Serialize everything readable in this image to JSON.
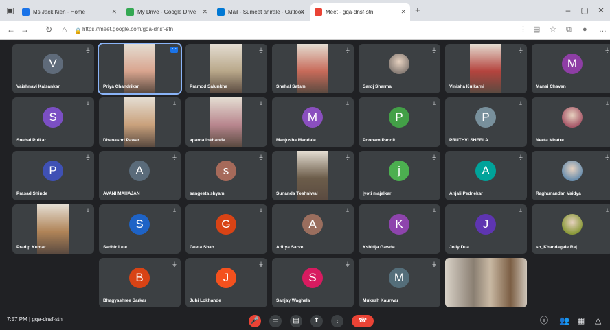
{
  "browser": {
    "tabs": [
      {
        "title": "Ms Jack Kien - Home",
        "color": "#1a73e8"
      },
      {
        "title": "My Drive - Google Drive",
        "color": "#34a853"
      },
      {
        "title": "Mail - Sumeet ahirale - Outlook",
        "color": "#0078d4"
      },
      {
        "title": "Meet - gqa-dnsf-stn",
        "color": "#ea4335"
      }
    ],
    "url": "https://meet.google.com/gqa-dnsf-stn",
    "new_tab": "+"
  },
  "participants": [
    {
      "name": "Vaishnavi Kalsankar",
      "initial": "V",
      "color": "#5f6b7a",
      "type": "avatar"
    },
    {
      "name": "Priya Chandrikar",
      "initial": "",
      "color": "#d9a58f",
      "type": "photo"
    },
    {
      "name": "Pramod Salunkhe",
      "initial": "",
      "color": "#b9a88a",
      "type": "photo"
    },
    {
      "name": "Snehal Satam",
      "initial": "",
      "color": "#c86b5a",
      "type": "photo"
    },
    {
      "name": "Saroj Sharma",
      "initial": "",
      "color": "#8a7f78",
      "type": "small-photo"
    },
    {
      "name": "Vinisha Kulkarni",
      "initial": "",
      "color": "#b5443e",
      "type": "photo"
    },
    {
      "name": "Mansi Chavan",
      "initial": "M",
      "color": "#8e3ea5",
      "type": "avatar"
    },
    {
      "name": "Snehal Pulkar",
      "initial": "S",
      "color": "#7b4fc4",
      "type": "avatar"
    },
    {
      "name": "Dhanashri Pawar",
      "initial": "",
      "color": "#caa27d",
      "type": "photo"
    },
    {
      "name": "aparna lokhande",
      "initial": "",
      "color": "#b9878f",
      "type": "photo"
    },
    {
      "name": "Manjusha Mandale",
      "initial": "M",
      "color": "#8a4fbf",
      "type": "avatar"
    },
    {
      "name": "Poonam Pandit",
      "initial": "P",
      "color": "#43a047",
      "type": "avatar"
    },
    {
      "name": "PRUTHVI SHEELA",
      "initial": "P",
      "color": "#78909c",
      "type": "avatar"
    },
    {
      "name": "Neeta Mhatre",
      "initial": "",
      "color": "#a85a6a",
      "type": "small-photo"
    },
    {
      "name": "Prasad Shinde",
      "initial": "P",
      "color": "#3f51b5",
      "type": "avatar"
    },
    {
      "name": "AVANI MAHAJAN",
      "initial": "A",
      "color": "#5a6b7a",
      "type": "avatar"
    },
    {
      "name": "sangeeta shyam",
      "initial": "s",
      "color": "#a66a5a",
      "type": "avatar"
    },
    {
      "name": "Sunanda Toshniwal",
      "initial": "",
      "color": "#6c5d4a",
      "type": "photo"
    },
    {
      "name": "jyoti majalkar",
      "initial": "j",
      "color": "#4caf50",
      "type": "avatar"
    },
    {
      "name": "Anjali Pednekar",
      "initial": "A",
      "color": "#00a39a",
      "type": "avatar"
    },
    {
      "name": "Raghunandan Vaidya",
      "initial": "",
      "color": "#6b8fae",
      "type": "small-photo"
    },
    {
      "name": "Pradip Kumar",
      "initial": "",
      "color": "#b08458",
      "type": "photo"
    },
    {
      "name": "Sadhir Lele",
      "initial": "S",
      "color": "#1e63c6",
      "type": "avatar"
    },
    {
      "name": "Geeta Shah",
      "initial": "G",
      "color": "#d84315",
      "type": "avatar"
    },
    {
      "name": "Aditya Sarve",
      "initial": "A",
      "color": "#9a6e5e",
      "type": "avatar"
    },
    {
      "name": "Kshitija Gawde",
      "initial": "K",
      "color": "#8e44ad",
      "type": "avatar"
    },
    {
      "name": "Jolly Dua",
      "initial": "J",
      "color": "#5e35b1",
      "type": "avatar"
    },
    {
      "name": "sh_Khandagale Raj",
      "initial": "",
      "color": "#8b9a3a",
      "type": "small-photo"
    },
    {
      "name": "Bhagyashree Sarkar",
      "initial": "B",
      "color": "#d84315",
      "type": "avatar"
    },
    {
      "name": "Juhi Lokhande",
      "initial": "J",
      "color": "#f4511e",
      "type": "avatar"
    },
    {
      "name": "Sanjay Waghela",
      "initial": "S",
      "color": "#d81b60",
      "type": "avatar"
    },
    {
      "name": "Mukesh Kaurwar",
      "initial": "M",
      "color": "#546e7a",
      "type": "avatar"
    },
    {
      "name": "",
      "initial": "",
      "color": "#9b8e80",
      "type": "wide-photo"
    }
  ],
  "bottom": {
    "time": "7:57 PM",
    "separator": "|",
    "meeting_code": "gqa-dnsf-stn"
  },
  "colors": {
    "end_call": "#ea4335",
    "control_bg": "#3c4043",
    "pinned_outline": "#8ab4f8"
  }
}
